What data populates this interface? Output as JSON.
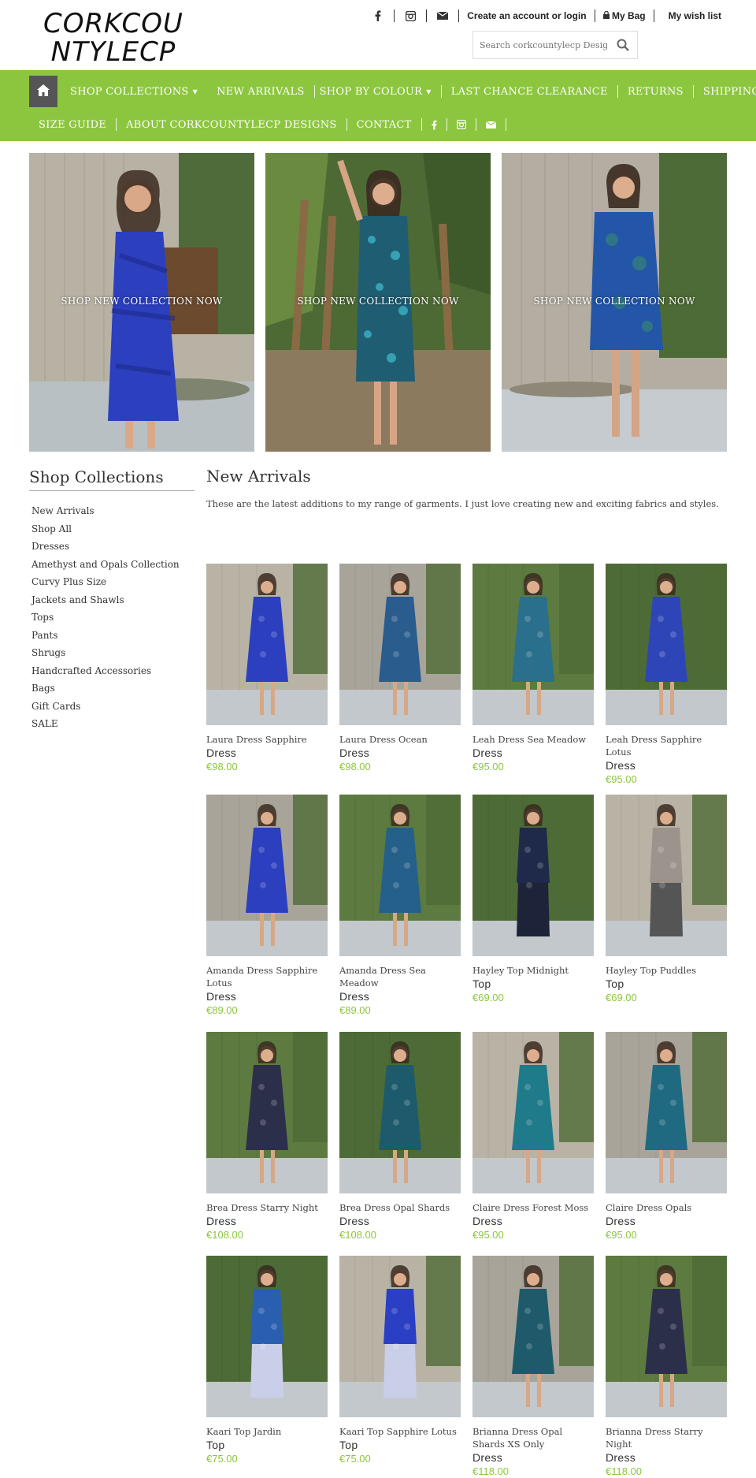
{
  "brand": {
    "logo_line1": "CORKCOU",
    "logo_line2": "NTYLECP"
  },
  "toplinks": {
    "account": "Create an account or login",
    "bag": "My Bag",
    "wishlist": "My wish list"
  },
  "search": {
    "placeholder": "Search corkcountylecp Designs"
  },
  "nav": {
    "row1": [
      "SHOP COLLECTIONS",
      "NEW ARRIVALS",
      "SHOP BY COLOUR",
      "LAST CHANCE CLEARANCE",
      "RETURNS",
      "SHIPPING"
    ],
    "row2": [
      "SIZE GUIDE",
      "ABOUT CORKCOUNTYLECP DESIGNS",
      "CONTACT"
    ]
  },
  "hero": {
    "cta1": "SHOP NEW COLLECTION NOW",
    "cta2": "SHOP NEW COLLECTION NOW",
    "cta3": "SHOP NEW COLLECTION NOW"
  },
  "sidebar": {
    "title": "Shop Collections",
    "items": [
      "New Arrivals",
      "Shop All",
      "Dresses",
      "Amethyst and Opals Collection",
      "Curvy Plus Size",
      "Jackets and Shawls",
      "Tops",
      "Pants",
      "Shrugs",
      "Handcrafted Accessories",
      "Bags",
      "Gift Cards",
      "SALE"
    ]
  },
  "main": {
    "title": "New Arrivals",
    "intro": "These are the latest additions to my range of garments. I just love creating new and exciting fabrics and styles."
  },
  "products": [
    {
      "name": "Laura Dress Sapphire",
      "type": "Dress",
      "price": "€98.00"
    },
    {
      "name": "Laura Dress Ocean",
      "type": "Dress",
      "price": "€98.00"
    },
    {
      "name": "Leah Dress Sea Meadow",
      "type": "Dress",
      "price": "€95.00"
    },
    {
      "name": "Leah Dress Sapphire Lotus",
      "type": "Dress",
      "price": "€95.00"
    },
    {
      "name": "Amanda Dress Sapphire Lotus",
      "type": "Dress",
      "price": "€89.00"
    },
    {
      "name": "Amanda Dress Sea Meadow",
      "type": "Dress",
      "price": "€89.00"
    },
    {
      "name": "Hayley Top Midnight",
      "type": "Top",
      "price": "€69.00"
    },
    {
      "name": "Hayley Top Puddles",
      "type": "Top",
      "price": "€69.00"
    },
    {
      "name": "Brea Dress Starry Night",
      "type": "Dress",
      "price": "€108.00"
    },
    {
      "name": "Brea Dress Opal Shards",
      "type": "Dress",
      "price": "€108.00"
    },
    {
      "name": "Claire Dress Forest Moss",
      "type": "Dress",
      "price": "€95.00"
    },
    {
      "name": "Claire Dress Opals",
      "type": "Dress",
      "price": "€95.00"
    },
    {
      "name": "Kaari Top Jardin",
      "type": "Top",
      "price": "€75.00"
    },
    {
      "name": "Kaari Top Sapphire Lotus",
      "type": "Top",
      "price": "€75.00"
    },
    {
      "name": "Brianna Dress Opal Shards XS Only",
      "type": "Dress",
      "price": "€118.00"
    },
    {
      "name": "Brianna Dress Starry Night",
      "type": "Dress",
      "price": "€118.00"
    }
  ],
  "colors": {
    "accent": "#8cc63f",
    "home_button": "#555555"
  }
}
